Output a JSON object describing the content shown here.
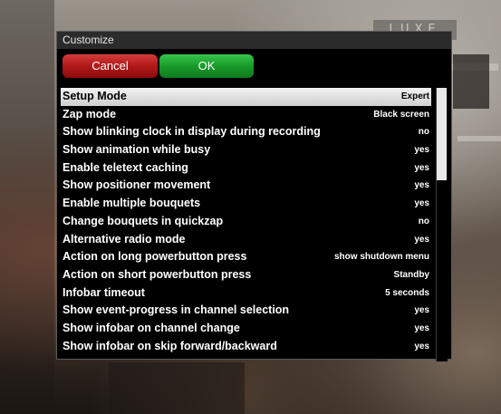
{
  "background": {
    "logo_text": "LUXE"
  },
  "window": {
    "title": "Customize",
    "buttons": {
      "cancel": "Cancel",
      "ok": "OK"
    },
    "settings": [
      {
        "label": "Setup Mode",
        "value": "Expert"
      },
      {
        "label": "Zap mode",
        "value": "Black screen"
      },
      {
        "label": "Show blinking clock in display during recording",
        "value": "no"
      },
      {
        "label": "Show animation while busy",
        "value": "yes"
      },
      {
        "label": "Enable teletext caching",
        "value": "yes"
      },
      {
        "label": "Show positioner movement",
        "value": "yes"
      },
      {
        "label": "Enable multiple bouquets",
        "value": "yes"
      },
      {
        "label": "Change bouquets in quickzap",
        "value": "no"
      },
      {
        "label": "Alternative radio mode",
        "value": "yes"
      },
      {
        "label": "Action on long powerbutton press",
        "value": "show shutdown menu"
      },
      {
        "label": "Action on short powerbutton press",
        "value": "Standby"
      },
      {
        "label": "Infobar timeout",
        "value": "5 seconds"
      },
      {
        "label": "Show event-progress in channel selection",
        "value": "yes"
      },
      {
        "label": "Show infobar on channel change",
        "value": "yes"
      },
      {
        "label": "Show infobar on skip forward/backward",
        "value": "yes"
      }
    ],
    "selected_index": 0,
    "scroll_position_fraction": 0.0
  },
  "colors": {
    "cancel": "#b01818",
    "ok": "#1a9a2a",
    "selection": "#e6e6e6"
  }
}
